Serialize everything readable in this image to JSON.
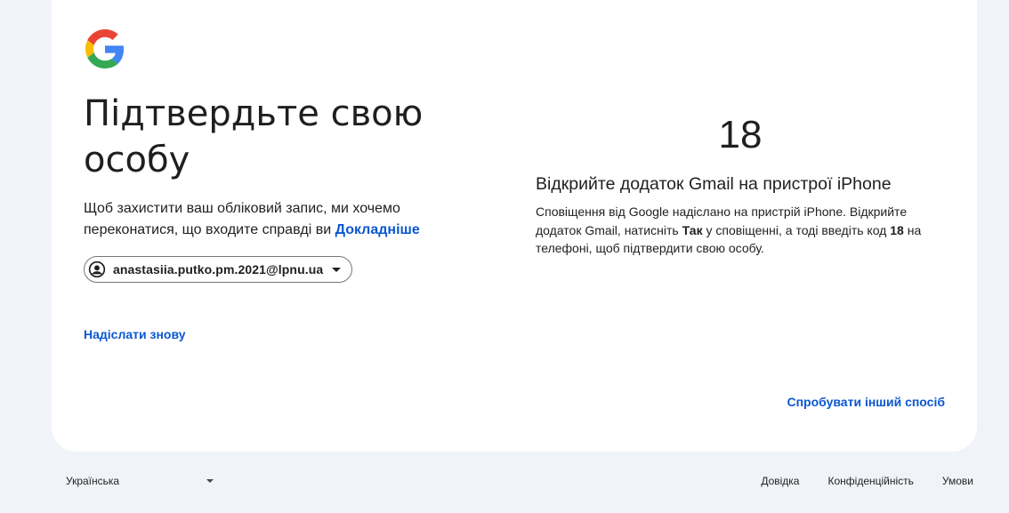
{
  "page": {
    "title": "Підтвердьте свою особу",
    "subtitle": "Щоб захистити ваш обліковий запис, ми хочемо переконатися, що входите справді ви",
    "learn_more_link": "Докладніше"
  },
  "account": {
    "email": "anastasiia.putko.pm.2021@lpnu.ua"
  },
  "actions": {
    "resend_label": "Надіслати знову",
    "try_another_label": "Спробувати інший спосіб"
  },
  "verification": {
    "code": "18",
    "heading": "Відкрийте додаток Gmail на пристрої iPhone",
    "body_part1": "Сповіщення від Google надіслано на пристрій iPhone. Відкрийте додаток Gmail, натисніть ",
    "body_bold_yes": "Так",
    "body_part2": " у сповіщенні, а тоді введіть код ",
    "body_bold_code": "18",
    "body_part3": " на телефоні, щоб підтвердити свою особу."
  },
  "footer": {
    "language": "Українська",
    "links": {
      "help": "Довідка",
      "privacy": "Конфіденційність",
      "terms": "Умови"
    }
  },
  "colors": {
    "background": "#f0f4f9",
    "card": "#ffffff",
    "link": "#0b57d0",
    "text": "#1f1f1f"
  },
  "icons": {
    "logo": "google-g-logo",
    "account": "account-circle-icon",
    "dropdown": "chevron-down-icon"
  }
}
